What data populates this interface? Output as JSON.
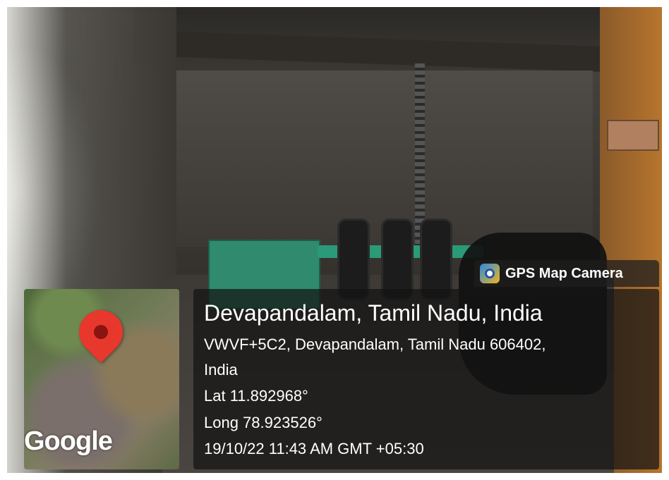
{
  "badge": {
    "app_name": "GPS Map Camera",
    "icon": "camera-pin-icon"
  },
  "map": {
    "logo_text": "Google",
    "marker": "location-pin-icon"
  },
  "location": {
    "title": "Devapandalam, Tamil Nadu, India",
    "address_line1": "VWVF+5C2, Devapandalam, Tamil Nadu 606402,",
    "address_line2": "India",
    "lat": "Lat 11.892968°",
    "long": "Long 78.923526°",
    "datetime": "19/10/22 11:43 AM GMT +05:30"
  }
}
